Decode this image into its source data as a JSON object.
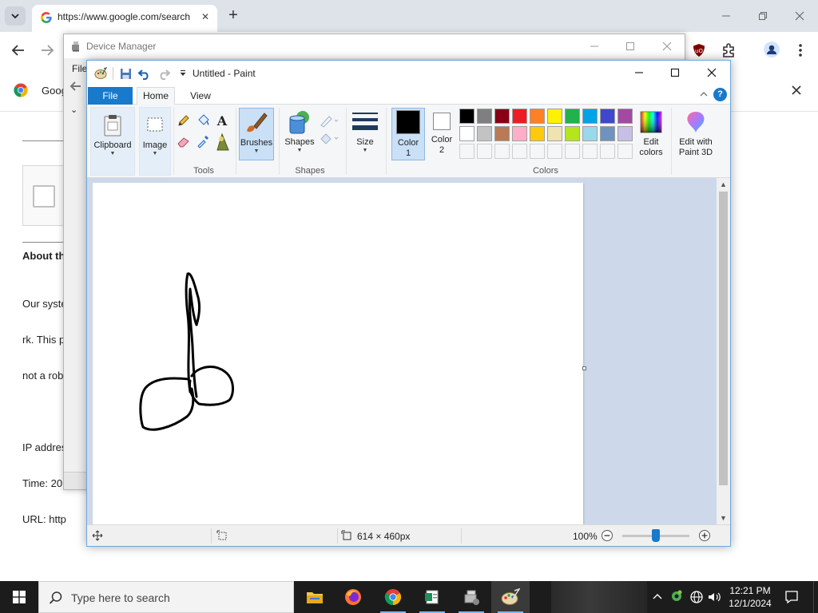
{
  "chrome": {
    "tab_title": "https://www.google.com/search",
    "infobar_text": "Goog",
    "page": {
      "about_heading": "About th",
      "body_lines": [
        "Our syste",
        "rk. This p",
        "not a rob",
        "",
        "IP addres",
        "Time: 20",
        "URL: http"
      ]
    }
  },
  "device_manager": {
    "title": "Device Manager",
    "menu_file": "File"
  },
  "paint": {
    "title": "Untitled - Paint",
    "tabs": {
      "file": "File",
      "home": "Home",
      "view": "View"
    },
    "groups": {
      "tools": "Tools",
      "shapes": "Shapes",
      "colors": "Colors"
    },
    "buttons": {
      "clipboard": "Clipboard",
      "image": "Image",
      "brushes": "Brushes",
      "shapes": "Shapes",
      "size": "Size",
      "color1_line1": "Color",
      "color1_line2": "1",
      "color2_line1": "Color",
      "color2_line2": "2",
      "edit_colors_line1": "Edit",
      "edit_colors_line2": "colors",
      "paint3d_line1": "Edit with",
      "paint3d_line2": "Paint 3D"
    },
    "color1": "#000000",
    "color2": "#ffffff",
    "palette": [
      "#000000",
      "#7f7f7f",
      "#880015",
      "#ed1c24",
      "#ff7f27",
      "#fff200",
      "#22b14c",
      "#00a2e8",
      "#3f48cc",
      "#a349a4",
      "#ffffff",
      "#c3c3c3",
      "#b97a57",
      "#ffaec9",
      "#ffc90e",
      "#efe4b0",
      "#b5e61d",
      "#99d9ea",
      "#7092be",
      "#c8bfe7"
    ],
    "status": {
      "canvas_size": "614 × 460px",
      "zoom": "100%"
    }
  },
  "taskbar": {
    "search_placeholder": "Type here to search",
    "time": "12:21 PM",
    "date": "12/1/2024"
  }
}
